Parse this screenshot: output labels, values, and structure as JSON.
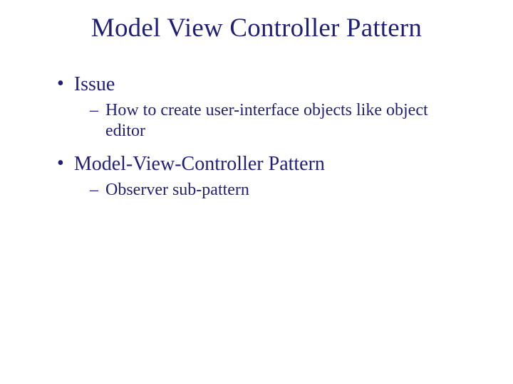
{
  "title": "Model View Controller Pattern",
  "bullets": [
    {
      "level1": "Issue",
      "level2": "How to create user-interface objects like object editor"
    },
    {
      "level1": "Model-View-Controller Pattern",
      "level2": "Observer sub-pattern"
    }
  ]
}
